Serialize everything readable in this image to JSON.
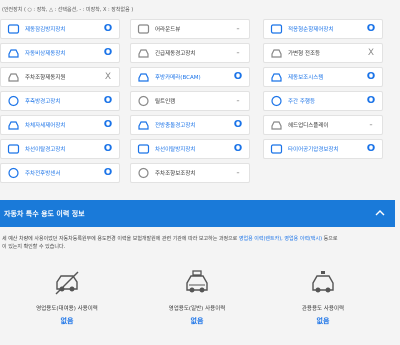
{
  "legend": "(안전장치 ( ○ : 장착, △ : 선택옵션, - : 미장착, X : 장착없음 )",
  "options": {
    "col1": [
      {
        "name": "제동잠김방지장치",
        "status": "O",
        "icon": "abs-icon",
        "highlight": true
      },
      {
        "name": "자동비상제동장치",
        "status": "O",
        "icon": "auto-brake-icon",
        "highlight": true
      },
      {
        "name": "주차조향제동지원",
        "status": "X",
        "icon": "parking-assist-icon",
        "highlight": false
      },
      {
        "name": "후측방경고장치",
        "status": "O",
        "icon": "blind-spot-icon",
        "highlight": true
      },
      {
        "name": "차체자세제어장치",
        "status": "O",
        "icon": "esc-icon",
        "highlight": true
      },
      {
        "name": "차선이탈경고장치",
        "status": "O",
        "icon": "lane-departure-icon",
        "highlight": true
      },
      {
        "name": "주차전후방센서",
        "status": "O",
        "icon": "parking-sensor-icon",
        "highlight": true
      }
    ],
    "col2": [
      {
        "name": "어라운드뷰",
        "status": "-",
        "icon": "around-view-icon",
        "highlight": false
      },
      {
        "name": "긴급제동경고장치",
        "status": "-",
        "icon": "emergency-warning-icon",
        "highlight": false
      },
      {
        "name": "후방카메라(BCAM)",
        "status": "O",
        "icon": "rear-camera-icon",
        "highlight": true
      },
      {
        "name": "릴트인캠",
        "status": "-",
        "icon": "builtin-cam-icon",
        "highlight": false
      },
      {
        "name": "전방충돌경고장치",
        "status": "O",
        "icon": "forward-collision-icon",
        "highlight": true
      },
      {
        "name": "차선이탈방지장치",
        "status": "O",
        "icon": "lane-keeping-icon",
        "highlight": true
      },
      {
        "name": "주차조향보조장치",
        "status": "-",
        "icon": "parking-steering-icon",
        "highlight": false
      }
    ],
    "col3": [
      {
        "name": "적응형순항제어장치",
        "status": "O",
        "icon": "cruise-control-icon",
        "highlight": true
      },
      {
        "name": "가변형 전조등",
        "status": "X",
        "icon": "adaptive-headlamp-icon",
        "highlight": false
      },
      {
        "name": "제동보조시스템",
        "status": "O",
        "icon": "brake-assist-icon",
        "highlight": true
      },
      {
        "name": "주간 주행등",
        "status": "O",
        "icon": "drl-icon",
        "highlight": true
      },
      {
        "name": "헤드업디스플레이",
        "status": "-",
        "icon": "hud-icon",
        "highlight": false
      },
      {
        "name": "타이어공기압경보장치",
        "status": "O",
        "icon": "tpms-icon",
        "highlight": true
      },
      {
        "name": "",
        "status": "",
        "icon": "",
        "highlight": false
      }
    ]
  },
  "banner": {
    "title": "자동차 특수 용도 이력 정보",
    "toggle_icon": "chevron-up-icon"
  },
  "notice": {
    "text1": "세 예산 차량에 사용이었던 자동차등록원부에 용도변경 이력을 보험개발원에 관련 기관에 따라 보고하는 과정으로 ",
    "link": "영업용 이력(렌트카), 영업용 이력(택시)",
    "text2": " 등으로",
    "text3": "이 있는지 확인할 수 있습니다."
  },
  "usage": [
    {
      "label": "영업용도(대여용) 사용이력",
      "value": "없음",
      "icon": "rental-car-icon"
    },
    {
      "label": "영업용도(일반) 사용이력",
      "value": "없음",
      "icon": "taxi-icon"
    },
    {
      "label": "관용용도 사용이력",
      "value": "없음",
      "icon": "government-car-icon"
    }
  ]
}
